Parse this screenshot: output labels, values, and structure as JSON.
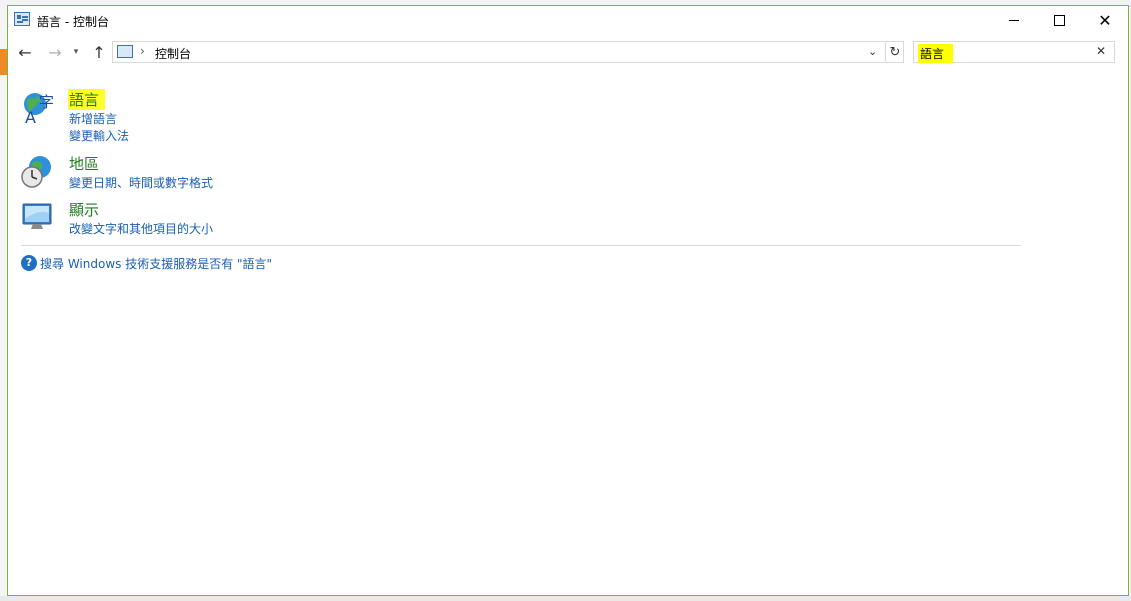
{
  "window": {
    "title": "語言 - 控制台"
  },
  "nav": {
    "breadcrumb": "控制台",
    "chevron": "›",
    "search_value": "語言"
  },
  "results": [
    {
      "heading": "語言",
      "links": [
        "新增語言",
        "變更輸入法"
      ]
    },
    {
      "heading": "地區",
      "links": [
        "變更日期、時間或數字格式"
      ]
    },
    {
      "heading": "顯示",
      "links": [
        "改變文字和其他項目的大小"
      ]
    }
  ],
  "help": {
    "text": "搜尋 Windows 技術支援服務是否有 \"語言\""
  },
  "glyphs": {
    "back": "←",
    "forward": "→",
    "recent": "▾",
    "up": "↑",
    "dropdown": "⌄",
    "refresh": "↻",
    "clear": "✕",
    "close": "✕",
    "help": "?"
  },
  "icons": {
    "app": "control-panel-icon",
    "language": "language-globe-icon",
    "region": "globe-clock-icon",
    "display": "monitor-icon"
  },
  "colors": {
    "heading": "#1e7d1e",
    "link": "#1a5fb4",
    "highlight": "#ffff00",
    "window_border": "#7cb342"
  }
}
